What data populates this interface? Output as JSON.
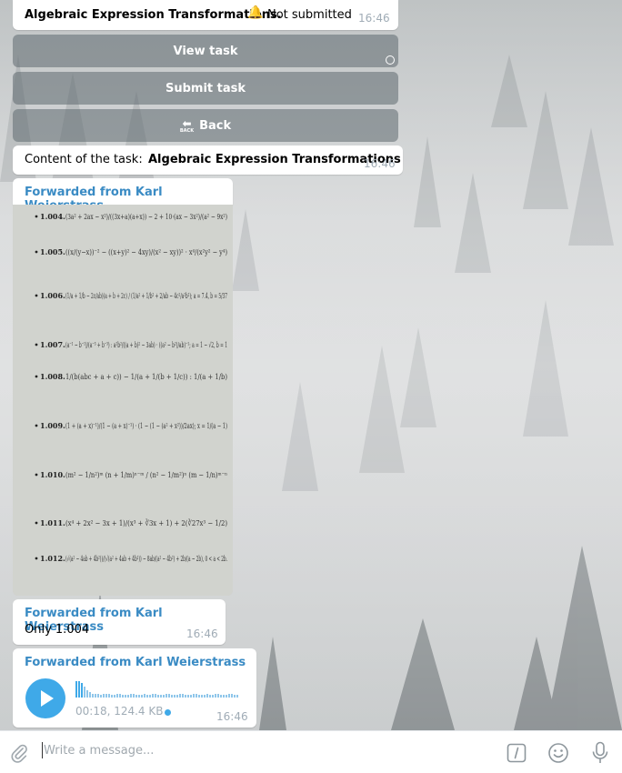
{
  "messages": {
    "header_bubble": {
      "title": "Algebraic Expression Transformations.",
      "status": "Not submitted",
      "time": "16:46"
    },
    "keyboard": {
      "view_task": "View task",
      "submit_task": "Submit task",
      "back": "Back",
      "back_icon_text": "BACK"
    },
    "content_bubble": {
      "prefix": "Content of the task: ",
      "title": "Algebraic Expression Transformations",
      "time": "16:46"
    },
    "photo_message": {
      "forwarded_from": "Forwarded from Karl Weierstrass",
      "exercises": [
        {
          "num": "1.004.",
          "expr": "(3a² + 2ax − x²)/((3x+a)(a+x)) − 2 + 10·(ax − 3x²)/(a² − 9x²)"
        },
        {
          "num": "1.005.",
          "expr": "((x/(y−x))⁻² − ((x+y)² − 4xy)/(x² − xy))² · x⁴/(x²y² − y⁴)"
        },
        {
          "num": "1.006.",
          "expr": "(1/a + 1/b − 2c/ab)(a + b + 2c) / (1/a² + 1/b² + 2/ab − 4c²/a²b²); a = 7.4, b = 5/37"
        },
        {
          "num": "1.007.",
          "expr": "(a⁻¹ − b⁻¹)/(a⁻³ + b⁻³) : a²b²/((a + b)² − 3ab) · ((a² − b²)/ab)⁻¹; a = 1 − √2, b = 1"
        },
        {
          "num": "1.008.",
          "expr": "1/(b(abc + a + c)) − 1/(a + 1/(b + 1/c)) : 1/(a + 1/b)"
        },
        {
          "num": "1.009.",
          "expr": "(1 + (a + x)⁻¹)/(1 − (a + x)⁻¹) · (1 − (1 − (a² + x²))/2ax); x = 1/(a − 1)"
        },
        {
          "num": "1.010.",
          "expr": "(m² − 1/n²)ᵐ (n + 1/m)ⁿ⁻ᵐ / (n² − 1/m²)ⁿ (m − 1/n)ᵐ⁻ⁿ"
        },
        {
          "num": "1.011.",
          "expr": "(x⁴ + 2x² − 3x + 1)/(x³ + ∛3x + 1) + 2(∛27x³ − 1/2)"
        },
        {
          "num": "1.012.",
          "expr": "(√(a² − 4ab + 4b²))/(√(a² + 4ab + 4b²)) − 8ab/(a² − 4b²) + 2b/(a − 2b), 0 < a < 2b."
        }
      ]
    },
    "text_message": {
      "forwarded_from": "Forwarded from Karl Weierstrass",
      "text": "Only 1.004",
      "time": "16:46"
    },
    "voice_message": {
      "forwarded_from": "Forwarded from Karl Weierstrass",
      "meta": "00:18, 124.4 KB",
      "time": "16:46"
    }
  },
  "composer": {
    "placeholder": "Write a message..."
  },
  "colors": {
    "accent": "#3a8bc4",
    "voice_button": "#3fa9e8",
    "time": "#a0acb6"
  }
}
